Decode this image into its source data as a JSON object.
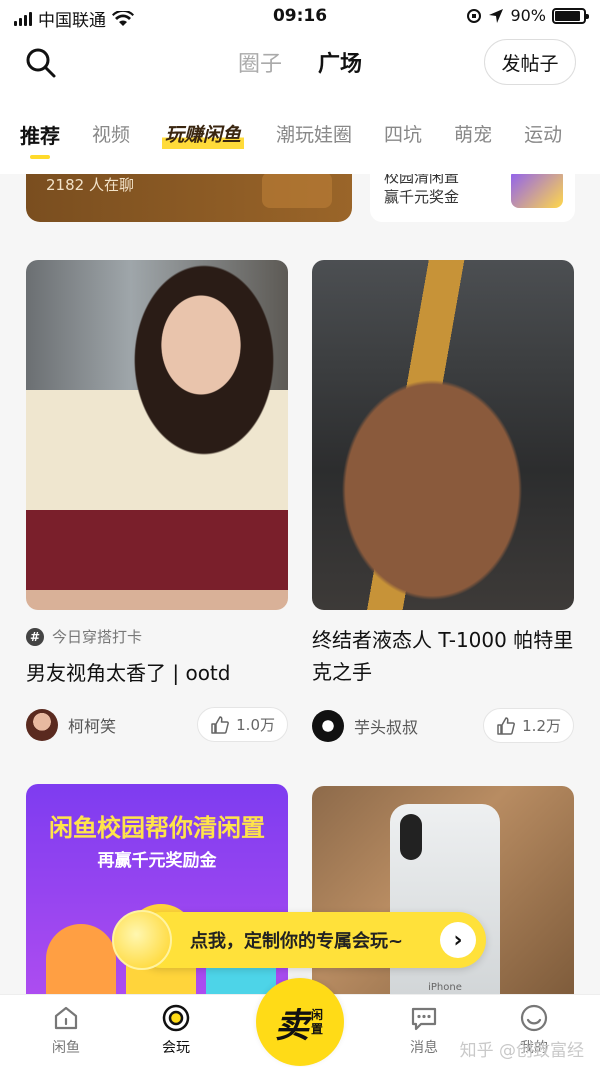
{
  "status_bar": {
    "carrier": "中国联通",
    "time": "09:16",
    "battery": "90%",
    "battery_level": 0.9
  },
  "header": {
    "segments": [
      "圈子",
      "广场"
    ],
    "active_segment": "广场",
    "post_button": "发帖子"
  },
  "tabs": [
    {
      "label": "推荐",
      "active": true
    },
    {
      "label": "视频"
    },
    {
      "label": "玩赚闲鱼",
      "special": true
    },
    {
      "label": "潮玩娃圈"
    },
    {
      "label": "四坑"
    },
    {
      "label": "萌宠"
    },
    {
      "label": "运动"
    }
  ],
  "banners": {
    "left_text": "2182 人在聊",
    "right_line1": "校园清闲置",
    "right_line2": "赢千元奖金"
  },
  "cards": [
    {
      "tag": "今日穿搭打卡",
      "title": "男友视角太香了 | ootd",
      "author": "柯柯笑",
      "likes": "1.0万"
    },
    {
      "title": "终结者液态人 T-1000 帕特里克之手",
      "author": "芋头叔叔",
      "likes": "1.2万"
    },
    {
      "promo_line1": "闲鱼校园帮你清闲置",
      "promo_line2": "再赢千元奖励金"
    },
    {
      "phone_label": "iPhone"
    }
  ],
  "toast": {
    "message": "点我，定制你的专属会玩~"
  },
  "bottom_nav": {
    "items": [
      "闲鱼",
      "会玩",
      "消息",
      "我的"
    ],
    "sell_big": "卖",
    "sell_small": "闲置"
  },
  "watermark": "知乎 @创致富经",
  "colors": {
    "accent": "#ffdb17",
    "background": "#f6f6f6"
  }
}
